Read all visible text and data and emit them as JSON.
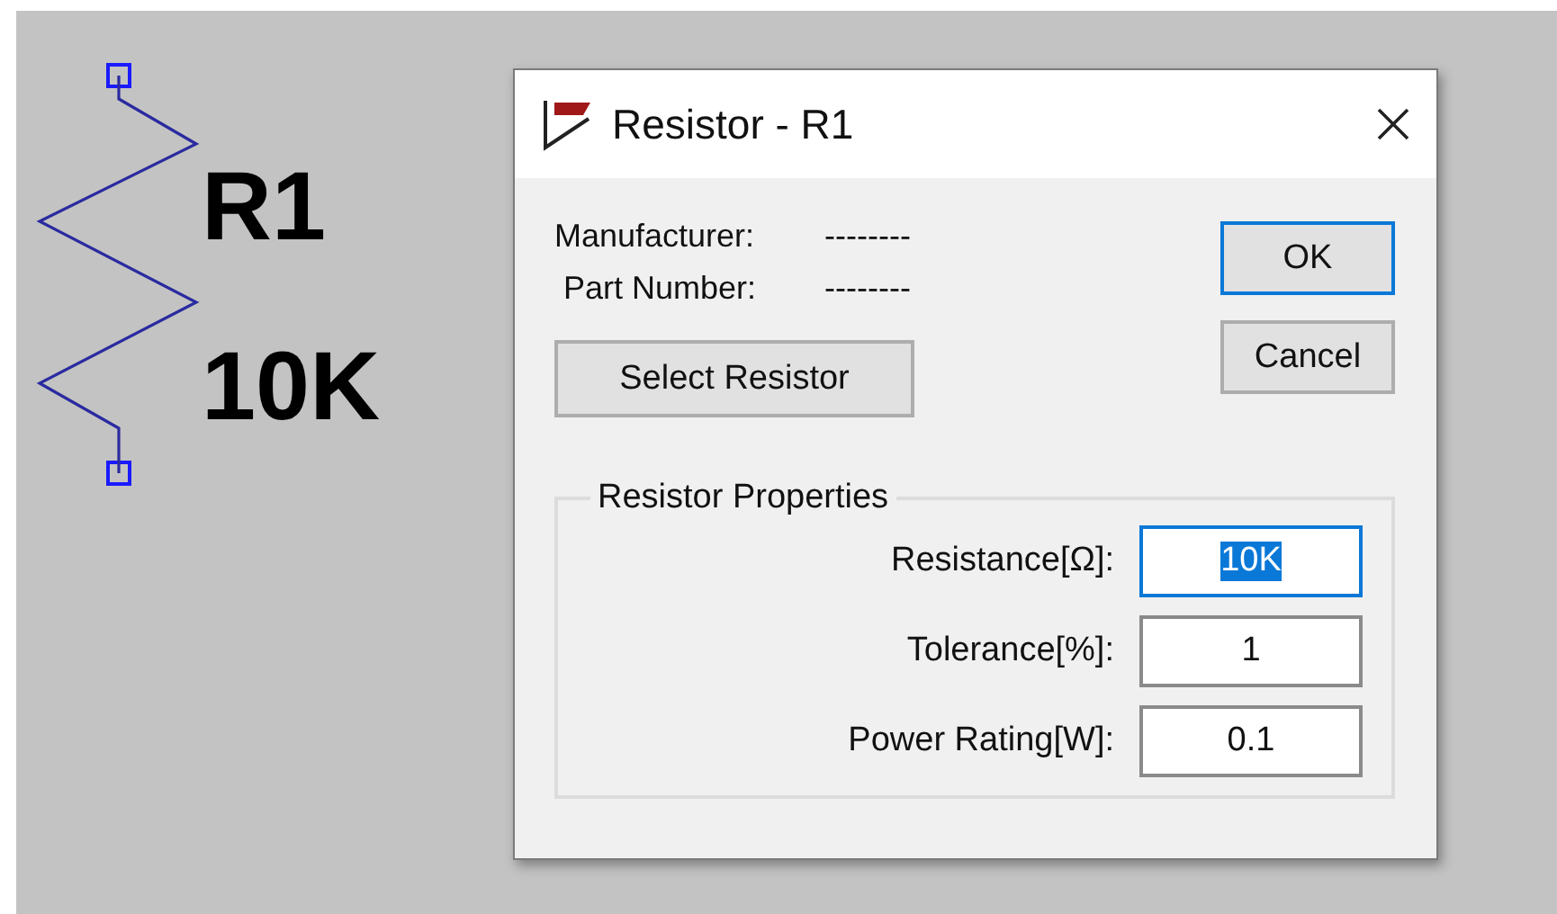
{
  "schematic": {
    "designator": "R1",
    "value": "10K"
  },
  "dialog": {
    "title": "Resistor - R1",
    "info": [
      {
        "label": "Manufacturer:",
        "value": "--------"
      },
      {
        "label": "Part Number:",
        "value": "--------"
      }
    ],
    "select_button": "Select Resistor",
    "buttons": [
      {
        "label": "OK",
        "default": true
      },
      {
        "label": "Cancel",
        "default": false
      }
    ],
    "group": {
      "title": "Resistor Properties",
      "fields": [
        {
          "label": "Resistance[Ω]:",
          "value": "10K",
          "focused": true
        },
        {
          "label": "Tolerance[%]:",
          "value": "1",
          "focused": false
        },
        {
          "label": "Power Rating[W]:",
          "value": "0.1",
          "focused": false
        }
      ]
    }
  }
}
